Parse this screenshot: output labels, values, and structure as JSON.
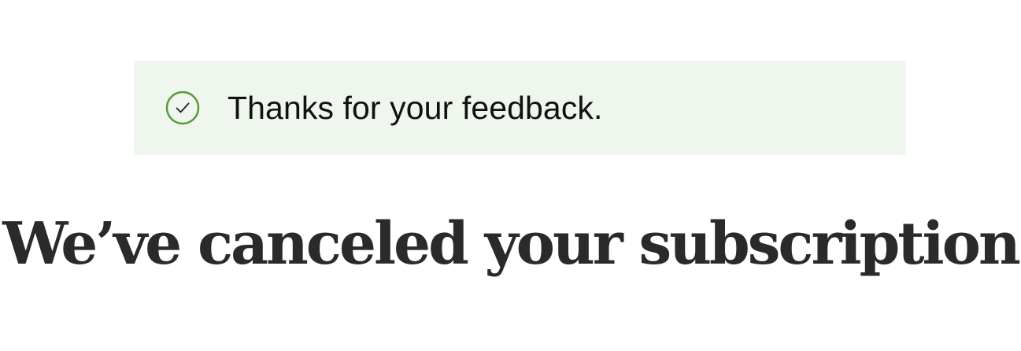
{
  "colors": {
    "notice_background": "#eff6ed",
    "success_icon": "#5a9a3c",
    "headline_text": "#2a2a2a"
  },
  "notice": {
    "icon": "check-circle-icon",
    "message": "Thanks for your feedback."
  },
  "headline": {
    "text": "We’ve canceled your subscription"
  }
}
